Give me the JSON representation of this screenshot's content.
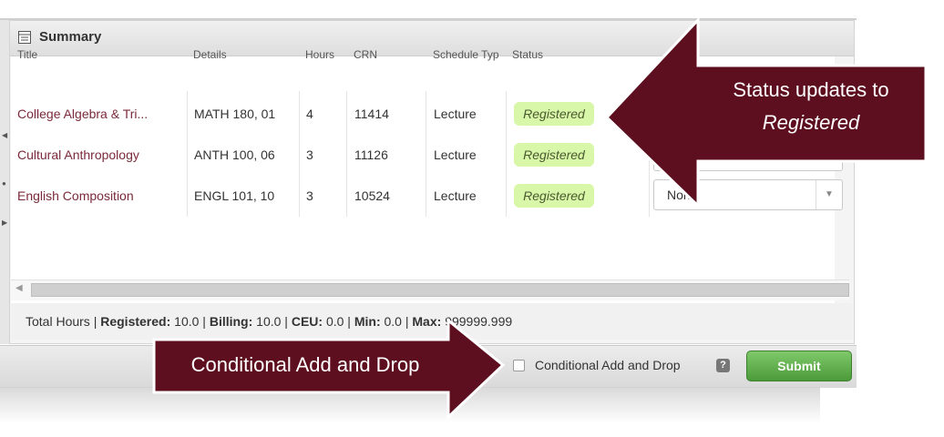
{
  "summary": {
    "title": "Summary",
    "columns": [
      "Title",
      "Details",
      "Hours",
      "CRN",
      "Schedule Typ",
      "Status"
    ],
    "rows": [
      {
        "title": "College Algebra & Tri...",
        "details": "MATH 180, 01",
        "hours": "4",
        "crn": "11414",
        "schedule": "Lecture",
        "status": "Registered"
      },
      {
        "title": "Cultural Anthropology",
        "details": "ANTH 100, 06",
        "hours": "3",
        "crn": "11126",
        "schedule": "Lecture",
        "status": "Registered"
      },
      {
        "title": "English Composition",
        "details": "ENGL 101, 10",
        "hours": "3",
        "crn": "10524",
        "schedule": "Lecture",
        "status": "Registered"
      }
    ],
    "action_dropdown_value": "None"
  },
  "totals": {
    "prefix": "Total Hours | ",
    "registered_label": "Registered:",
    "registered_value": "10.0",
    "billing_label": "Billing:",
    "billing_value": "10.0",
    "ceu_label": "CEU:",
    "ceu_value": "0.0",
    "min_label": "Min:",
    "min_value": "0.0",
    "max_label": "Max:",
    "max_value": "999999.999",
    "sep": " | "
  },
  "footer": {
    "checkbox_label": "Conditional Add and Drop",
    "help": "?",
    "submit_label": "Submit"
  },
  "callouts": {
    "status_line1": "Status updates to",
    "status_line2": "Registered",
    "conditional": "Conditional Add and Drop"
  },
  "colors": {
    "callout": "#5e0f1f",
    "badge": "#d9f7a8",
    "submit": "#5aa845",
    "link": "#7a2a3a"
  }
}
